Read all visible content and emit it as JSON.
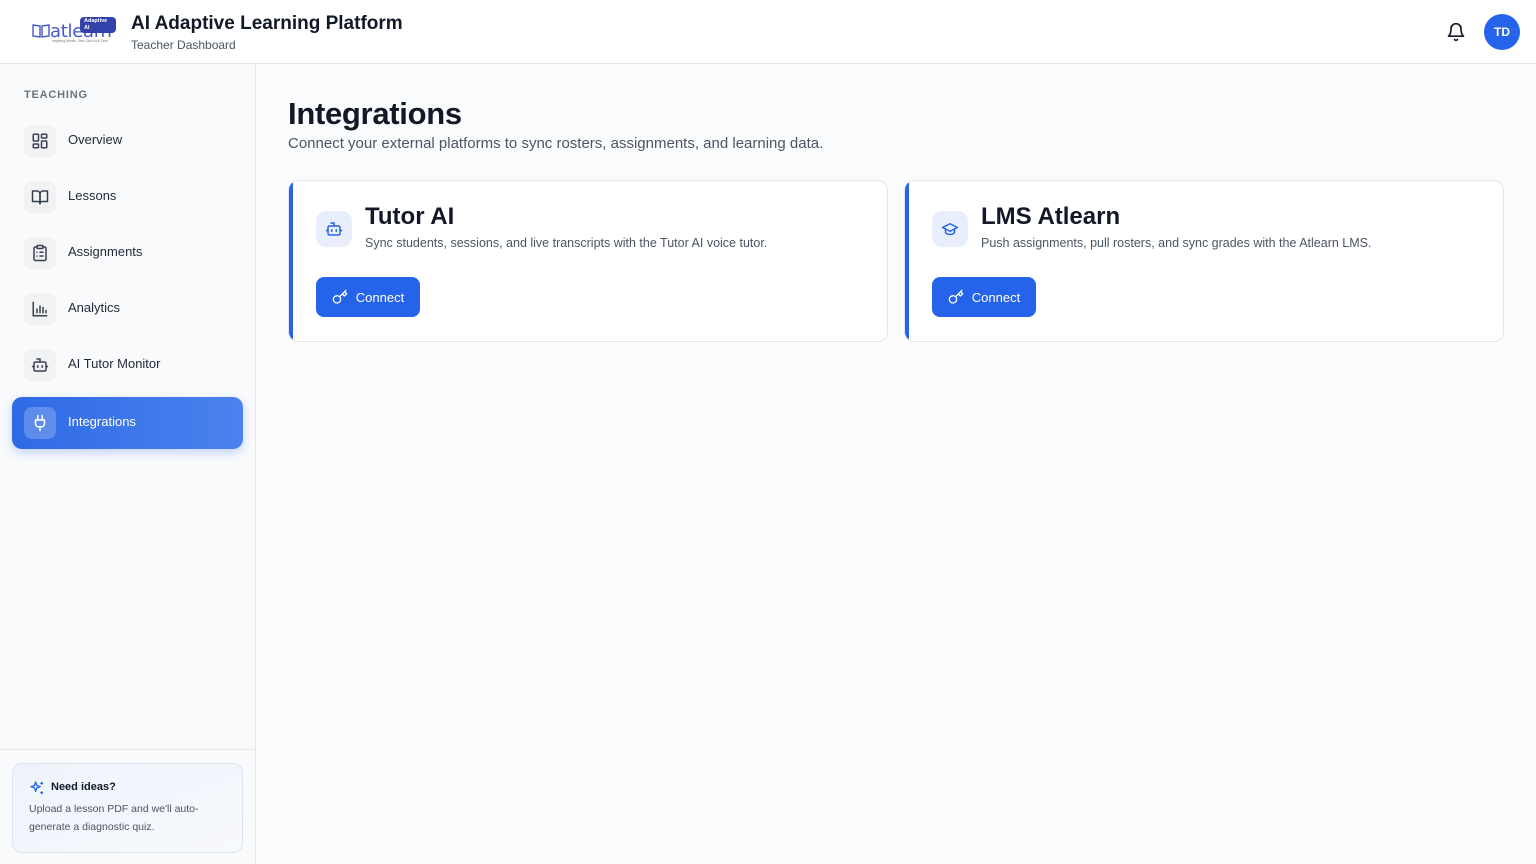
{
  "header": {
    "logo": {
      "wordmark": "atlearn",
      "badge": "Adaptive AI",
      "tagline": "Inspiring Minds, One Click At A Time"
    },
    "title": "AI Adaptive Learning Platform",
    "subtitle": "Teacher Dashboard",
    "notifications_icon": "bell-icon",
    "avatar_initials": "TD"
  },
  "sidebar": {
    "section_label": "TEACHING",
    "items": [
      {
        "label": "Overview",
        "icon": "grid-icon",
        "active": false
      },
      {
        "label": "Lessons",
        "icon": "book-icon",
        "active": false
      },
      {
        "label": "Assignments",
        "icon": "clipboard-icon",
        "active": false
      },
      {
        "label": "Analytics",
        "icon": "bar-chart-icon",
        "active": false
      },
      {
        "label": "AI Tutor Monitor",
        "icon": "robot-icon",
        "active": false
      },
      {
        "label": "Integrations",
        "icon": "plug-icon",
        "active": true
      }
    ],
    "tip": {
      "title": "Need ideas?",
      "body": "Upload a lesson PDF and we'll auto-generate a diagnostic quiz."
    }
  },
  "main": {
    "title": "Integrations",
    "description": "Connect your external platforms to sync rosters, assignments, and learning data.",
    "cards": [
      {
        "title": "Tutor AI",
        "description": "Sync students, sessions, and live transcripts with the Tutor AI voice tutor.",
        "icon": "robot-icon",
        "button_label": "Connect"
      },
      {
        "title": "LMS Atlearn",
        "description": "Push assignments, pull rosters, and sync grades with the Atlearn LMS.",
        "icon": "graduation-cap-icon",
        "button_label": "Connect"
      }
    ]
  },
  "colors": {
    "accent": "#2563eb",
    "text": "#111827",
    "muted": "#4b5563"
  }
}
